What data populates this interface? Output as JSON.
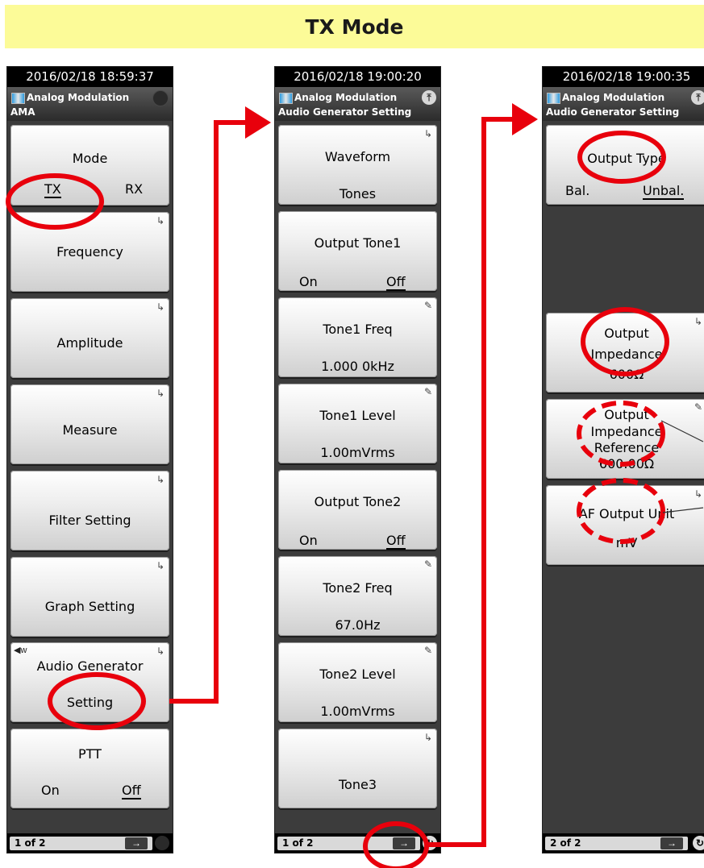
{
  "banner": {
    "title": "TX Mode"
  },
  "panels": [
    {
      "timestamp": "2016/02/18 18:59:37",
      "header_title": "Analog Modulation",
      "header_sub": "AMA",
      "footer_page": "1 of 2",
      "footer_next": "→",
      "buttons": [
        {
          "label": "Mode",
          "options": [
            "TX",
            "RX"
          ],
          "selected": "TX"
        },
        {
          "label": "Frequency"
        },
        {
          "label": "Amplitude"
        },
        {
          "label": "Measure"
        },
        {
          "label": "Filter Setting"
        },
        {
          "label": "Graph Setting"
        },
        {
          "label": "Audio Generator",
          "label2": "Setting"
        },
        {
          "label": "PTT",
          "options": [
            "On",
            "Off"
          ],
          "selected": "Off"
        }
      ]
    },
    {
      "timestamp": "2016/02/18 19:00:20",
      "header_title": "Analog Modulation",
      "header_sub": "Audio Generator Setting",
      "footer_page": "1 of 2",
      "footer_next": "→",
      "buttons": [
        {
          "label": "Waveform",
          "value": "Tones"
        },
        {
          "label": "Output Tone1",
          "options": [
            "On",
            "Off"
          ],
          "selected": "Off"
        },
        {
          "label": "Tone1 Freq",
          "value": "1.000 0kHz"
        },
        {
          "label": "Tone1 Level",
          "value": "1.00mVrms"
        },
        {
          "label": "Output Tone2",
          "options": [
            "On",
            "Off"
          ],
          "selected": "Off"
        },
        {
          "label": "Tone2 Freq",
          "value": "67.0Hz"
        },
        {
          "label": "Tone2 Level",
          "value": "1.00mVrms"
        },
        {
          "label": "Tone3"
        }
      ]
    },
    {
      "timestamp": "2016/02/18 19:00:35",
      "header_title": "Analog Modulation",
      "header_sub": "Audio Generator Setting",
      "footer_page": "2 of 2",
      "footer_next": "→",
      "buttons": [
        {
          "label": "Output Type",
          "options": [
            "Bal.",
            "Unbal."
          ],
          "selected": "Unbal."
        },
        {
          "label": "Output",
          "label2": "Impedance",
          "value": "600Ω"
        },
        {
          "label": "Output",
          "label2": "Impedance",
          "label3": "Reference",
          "value": "600.00Ω"
        },
        {
          "label": "AF Output Unit",
          "value": "mV"
        }
      ]
    }
  ],
  "colors": {
    "banner": "#fcfb98",
    "annotation": "#e8000c",
    "panel_bg": "#3c3c3c"
  }
}
